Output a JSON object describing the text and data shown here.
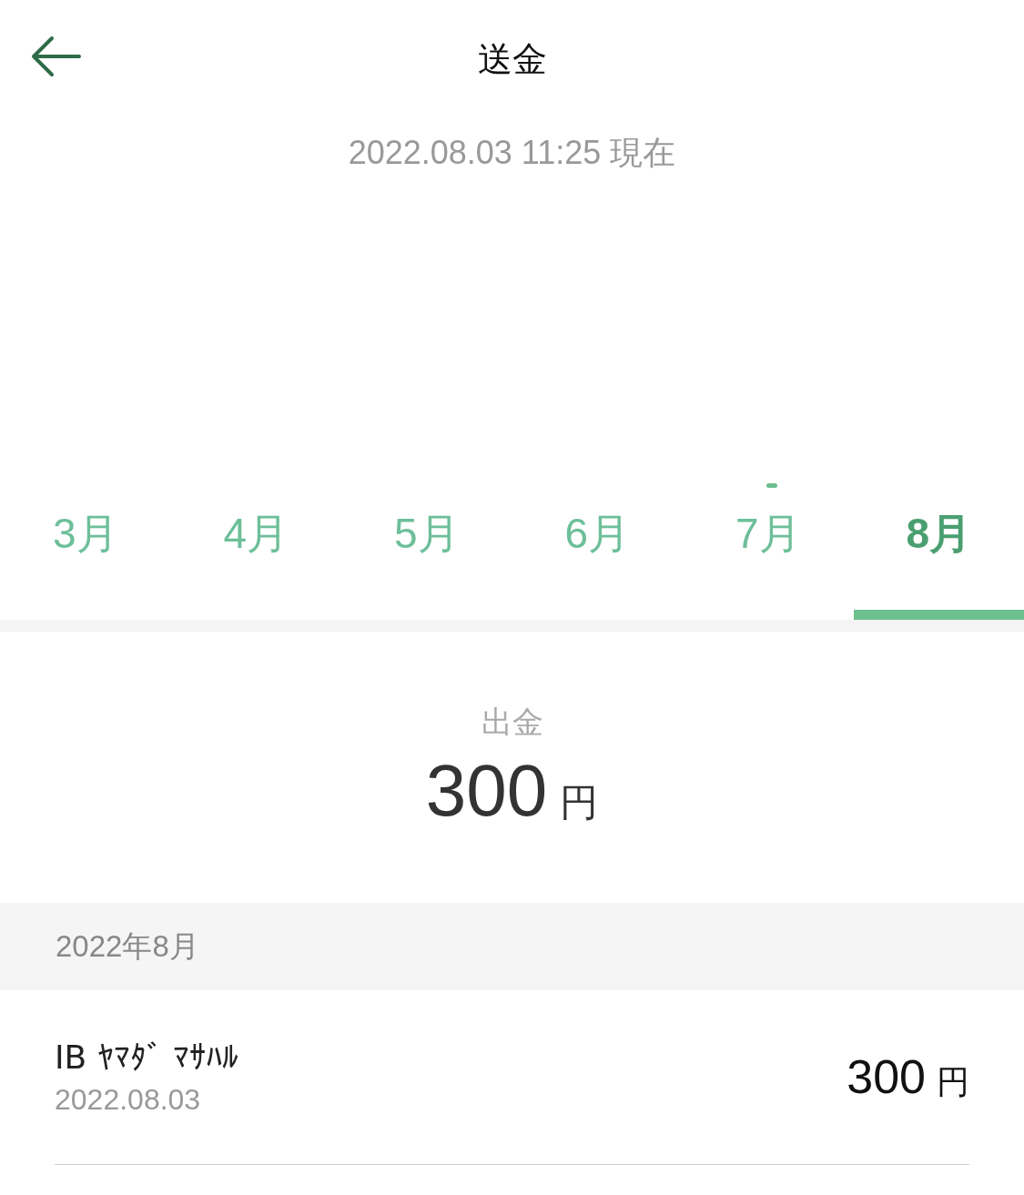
{
  "header": {
    "title": "送金"
  },
  "timestamp": "2022.08.03 11:25 現在",
  "months": [
    {
      "label": "3月",
      "selected": false,
      "has_bar": false
    },
    {
      "label": "4月",
      "selected": false,
      "has_bar": false
    },
    {
      "label": "5月",
      "selected": false,
      "has_bar": false
    },
    {
      "label": "6月",
      "selected": false,
      "has_bar": false
    },
    {
      "label": "7月",
      "selected": false,
      "has_bar": true
    },
    {
      "label": "8月",
      "selected": true,
      "has_bar": false
    }
  ],
  "summary": {
    "label": "出金",
    "amount": "300",
    "unit": "円"
  },
  "section": {
    "title": "2022年8月"
  },
  "transactions": [
    {
      "name": "IB ﾔﾏﾀﾞ ﾏｻﾊﾙ",
      "date": "2022.08.03",
      "amount": "300",
      "unit": "円"
    }
  ]
}
